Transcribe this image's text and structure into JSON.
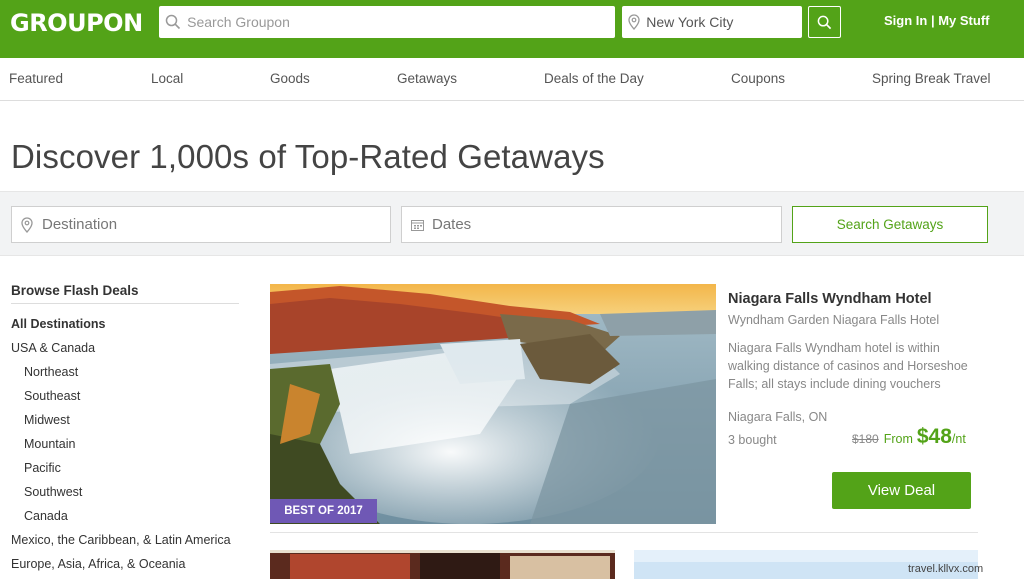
{
  "header": {
    "logo": "GROUPON",
    "search_placeholder": "Search Groupon",
    "location_value": "New York City",
    "sign_in": "Sign In",
    "separator": " | ",
    "my_stuff": "My Stuff"
  },
  "nav": {
    "items": [
      "Featured",
      "Local",
      "Goods",
      "Getaways",
      "Deals of the Day",
      "Coupons",
      "Spring Break Travel"
    ]
  },
  "page": {
    "headline": "Discover 1,000s of Top-Rated Getaways"
  },
  "filters": {
    "destination_placeholder": "Destination",
    "dates_placeholder": "Dates",
    "search_button": "Search Getaways"
  },
  "sidebar": {
    "title": "Browse Flash Deals",
    "items": [
      "All Destinations",
      "USA & Canada",
      "Northeast",
      "Southeast",
      "Midwest",
      "Mountain",
      "Pacific",
      "Southwest",
      "Canada",
      "Mexico, the Caribbean, & Latin America",
      "Europe, Asia, Africa, & Oceania"
    ]
  },
  "deal": {
    "badge": "BEST OF 2017",
    "title": "Niagara Falls Wyndham Hotel",
    "subtitle": "Wyndham Garden Niagara Falls Hotel",
    "description": "Niagara Falls Wyndham hotel is within walking distance of casinos and Horseshoe Falls; all stays include dining vouchers",
    "location": "Niagara Falls, ON",
    "bought": "3 bought",
    "old_price": "$180",
    "from": "From",
    "price": "$48",
    "per": "/nt",
    "cta": "View Deal"
  },
  "watermark": "travel.kllvx.com",
  "colors": {
    "brand_green": "#53a318",
    "badge_purple": "#6f58b5"
  }
}
